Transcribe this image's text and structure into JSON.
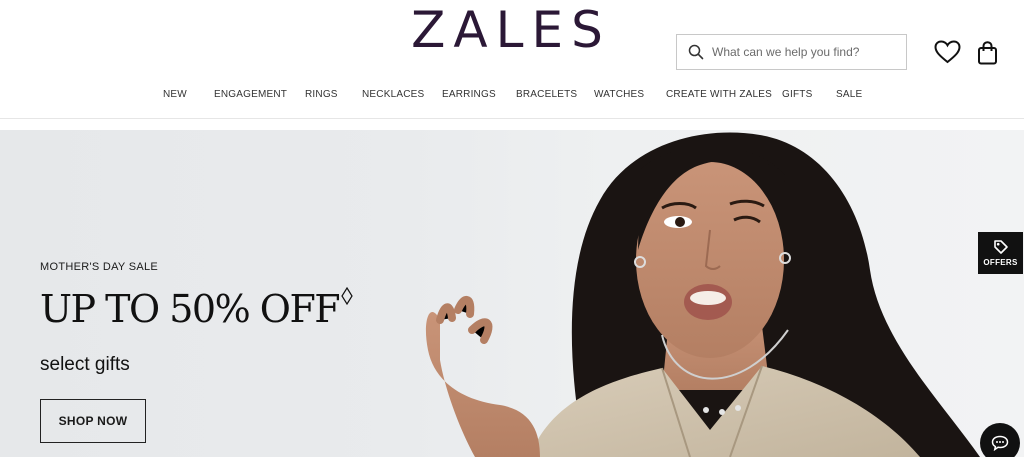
{
  "header": {
    "logo_text": "ZALES",
    "search": {
      "placeholder": "What can we help you find?"
    },
    "icons": {
      "search": "search-icon",
      "wishlist": "heart-icon",
      "bag": "shopping-bag-icon"
    }
  },
  "nav": {
    "items": [
      "NEW",
      "ENGAGEMENT",
      "RINGS",
      "NECKLACES",
      "EARRINGS",
      "BRACELETS",
      "WATCHES",
      "CREATE WITH ZALES",
      "GIFTS",
      "SALE"
    ]
  },
  "hero": {
    "eyebrow": "MOTHER'S DAY SALE",
    "headline": "UP TO 50% OFF",
    "subheadline": "select gifts",
    "cta_label": "SHOP NOW"
  },
  "side_tabs": {
    "offers_label": "OFFERS",
    "offers_icon": "tag-icon",
    "chat_icon": "chat-bubble-icon"
  },
  "colors": {
    "brand": "#2b1836",
    "hero_bg": "#e9ebed",
    "button_dark": "#111111"
  }
}
